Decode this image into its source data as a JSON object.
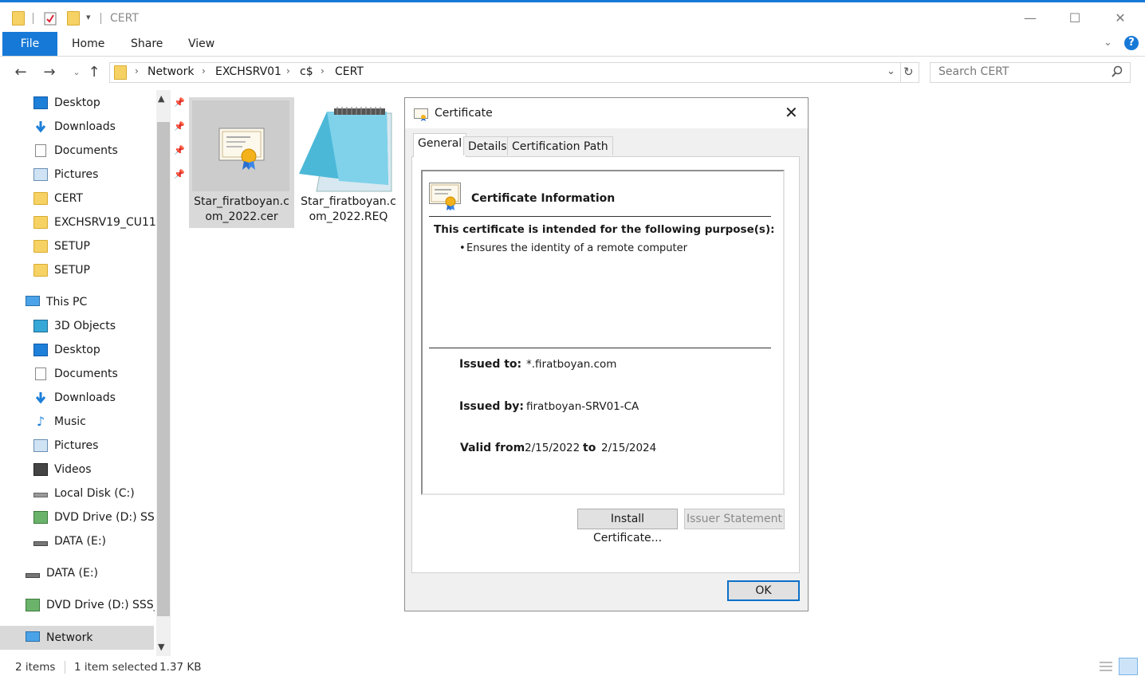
{
  "window": {
    "title": "CERT"
  },
  "ribbon": {
    "tabs": [
      "File",
      "Home",
      "Share",
      "View"
    ]
  },
  "address": {
    "crumbs": [
      "Network",
      "EXCHSRV01",
      "c$",
      "CERT"
    ],
    "search_placeholder": "Search CERT"
  },
  "sidebar": {
    "quick_access": [
      {
        "label": "Desktop",
        "icon": "desktop-icon",
        "pinned": true
      },
      {
        "label": "Downloads",
        "icon": "download-arrow-icon",
        "pinned": true
      },
      {
        "label": "Documents",
        "icon": "document-icon",
        "pinned": true
      },
      {
        "label": "Pictures",
        "icon": "pictures-icon",
        "pinned": true
      },
      {
        "label": "CERT",
        "icon": "folder-icon",
        "pinned": false
      },
      {
        "label": "EXCHSRV19_CU11",
        "icon": "folder-icon",
        "pinned": false
      },
      {
        "label": "SETUP",
        "icon": "folder-icon",
        "pinned": false
      },
      {
        "label": "SETUP",
        "icon": "folder-icon",
        "pinned": false
      }
    ],
    "this_pc": "This PC",
    "this_pc_items": [
      {
        "label": "3D Objects",
        "icon": "3d-objects-icon"
      },
      {
        "label": "Desktop",
        "icon": "desktop-icon"
      },
      {
        "label": "Documents",
        "icon": "document-icon"
      },
      {
        "label": "Downloads",
        "icon": "download-arrow-icon"
      },
      {
        "label": "Music",
        "icon": "music-icon"
      },
      {
        "label": "Pictures",
        "icon": "pictures-icon"
      },
      {
        "label": "Videos",
        "icon": "videos-icon"
      },
      {
        "label": "Local Disk (C:)",
        "icon": "local-disk-icon"
      },
      {
        "label": "DVD Drive (D:) SSS_",
        "icon": "dvd-drive-icon"
      },
      {
        "label": "DATA (E:)",
        "icon": "drive-icon"
      }
    ],
    "drives": [
      {
        "label": "DATA (E:)",
        "icon": "drive-icon"
      },
      {
        "label": "DVD Drive (D:) SSS_X",
        "icon": "dvd-drive-icon"
      }
    ],
    "network": "Network"
  },
  "files": [
    {
      "name_line1": "Star_firatboyan.c",
      "name_line2": "om_2022.cer",
      "icon": "certificate-file-icon",
      "selected": true
    },
    {
      "name_line1": "Star_firatboyan.c",
      "name_line2": "om_2022.REQ",
      "icon": "notepad-file-icon",
      "selected": false
    }
  ],
  "dialog": {
    "title": "Certificate",
    "tabs": [
      "General",
      "Details",
      "Certification Path"
    ],
    "info_heading": "Certificate Information",
    "purpose_heading": "This certificate is intended for the following purpose(s):",
    "purpose_item": "Ensures the identity of a remote computer",
    "issued_to_label": "Issued to:",
    "issued_to_value": "*.firatboyan.com",
    "issued_by_label": "Issued by:",
    "issued_by_value": "firatboyan-SRV01-CA",
    "valid_from_label": "Valid from",
    "valid_from_value": "2/15/2022",
    "valid_to_label": "to",
    "valid_to_value": "2/15/2024",
    "install_button": "Install Certificate...",
    "issuer_button": "Issuer Statement",
    "ok_button": "OK"
  },
  "status": {
    "item_count": "2 items",
    "selection": "1 item selected",
    "size": "1.37 KB"
  },
  "colors": {
    "accent": "#1779d7",
    "folder": "#f6d265",
    "selected_bg": "#d9d9d9"
  }
}
